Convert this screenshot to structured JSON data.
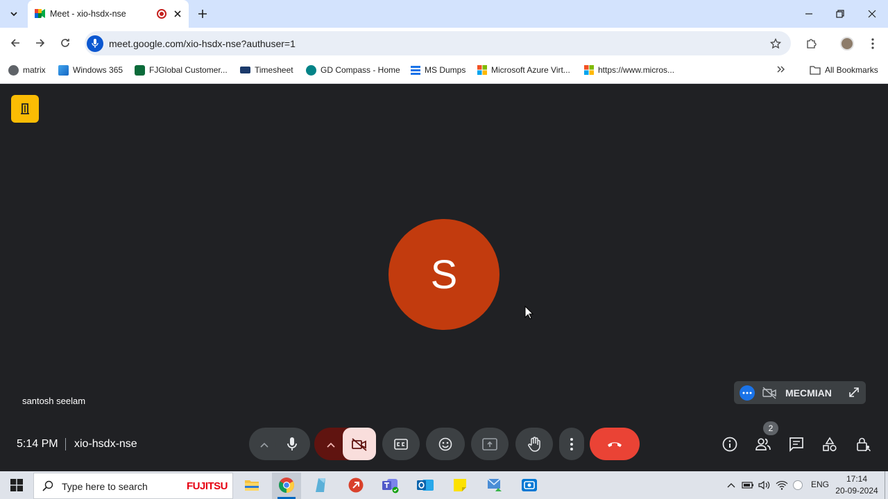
{
  "browser": {
    "tab_title": "Meet - xio-hsdx-nse",
    "url": "meet.google.com/xio-hsdx-nse?authuser=1",
    "bookmarks": [
      {
        "label": "matrix"
      },
      {
        "label": "Windows 365"
      },
      {
        "label": "FJGlobal Customer..."
      },
      {
        "label": "Timesheet"
      },
      {
        "label": "GD Compass - Home"
      },
      {
        "label": "MS Dumps"
      },
      {
        "label": "Microsoft Azure Virt..."
      },
      {
        "label": "https://www.micros..."
      }
    ],
    "all_bookmarks": "All Bookmarks"
  },
  "meet": {
    "avatar_initial": "S",
    "participant_name": "santosh seelam",
    "time": "5:14 PM",
    "meeting_code": "xio-hsdx-nse",
    "tile_name": "MECMIAN",
    "people_count": "2"
  },
  "taskbar": {
    "search_placeholder": "Type here to search",
    "brand": "FUJITSU",
    "language": "ENG",
    "clock_time": "17:14",
    "clock_date": "20-09-2024"
  },
  "colors": {
    "tabstrip": "#d3e3fd",
    "meet_bg": "#202124",
    "avatar": "#c23b0e",
    "end_call": "#ea4335",
    "camera_off_bg": "#f9dedc",
    "camera_off_arrow": "#601410"
  }
}
